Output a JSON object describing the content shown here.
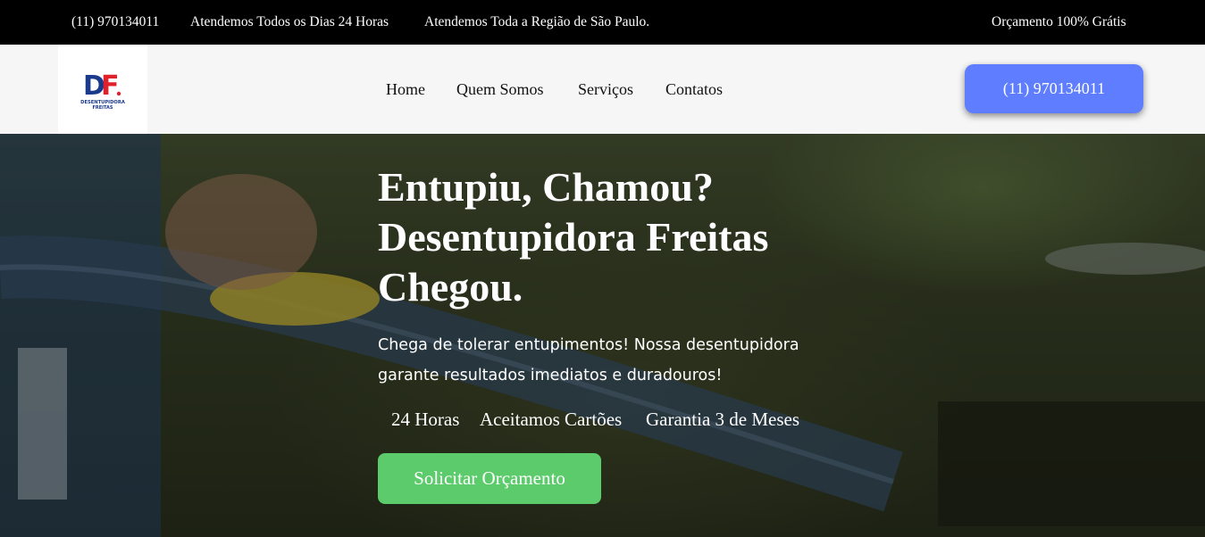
{
  "topbar": {
    "phone": "(11) 970134011",
    "hours": "Atendemos Todos os Dias 24 Horas",
    "region": "Atendemos Toda a Região de São Paulo.",
    "quote": "Orçamento 100% Grátis"
  },
  "header": {
    "logo_letters": "DF",
    "logo_line1": "DESENTUPIDORA",
    "logo_line2": "FREITAS",
    "nav": [
      "Home",
      "Quem Somos",
      "Serviços",
      "Contatos"
    ],
    "phone_button": "(11) 970134011"
  },
  "hero": {
    "title": "Entupiu, Chamou? Desentupidora Freitas Chegou.",
    "subtitle": "Chega de tolerar entupimentos! Nossa desentupidora garante resultados imediatos e duradouros!",
    "features": [
      "24 Horas",
      "Aceitamos Cartões",
      "Garantia 3 de Meses"
    ],
    "cta": "Solicitar Orçamento"
  },
  "colors": {
    "topbar_bg": "#000000",
    "header_bg": "#f6f6f6",
    "phone_button": "#5f7dff",
    "cta_button": "#5ccb6b",
    "logo_blue": "#1a3a8c",
    "logo_red": "#e0202a"
  }
}
